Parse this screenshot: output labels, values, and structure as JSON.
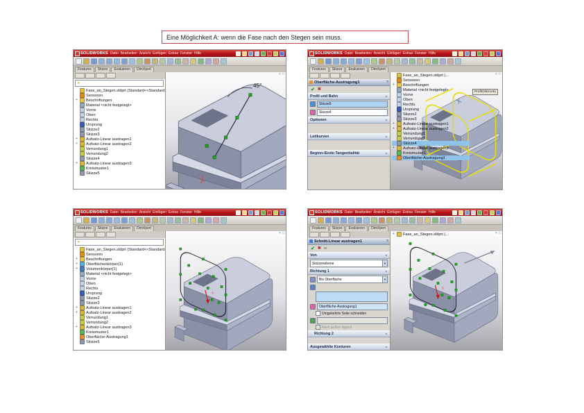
{
  "page": {
    "title_box": "Eine Möglichkeit A: wenn die Fase nach den Stegen sein muss."
  },
  "common": {
    "app_name": "SOLIDWORKS",
    "menu": [
      "Datei",
      "Bearbeiten",
      "Ansicht",
      "Einfügen",
      "Extras",
      "Fenster",
      "Hilfe"
    ],
    "tabs": [
      "Features",
      "Skizze",
      "Evaluieren",
      "DimXpert"
    ],
    "quickbar": [
      {
        "icon": "new"
      },
      {
        "icon": "open"
      },
      {
        "icon": "save"
      },
      {
        "icon": "print"
      },
      {
        "icon": "undo"
      },
      {
        "icon": "rebuild"
      },
      {
        "icon": "options"
      },
      {
        "icon": "help"
      }
    ],
    "toolbar": [
      {
        "icon": "select"
      },
      {
        "icon": "sketch-tool"
      },
      {
        "icon": "line"
      },
      {
        "icon": "rectangle"
      },
      {
        "icon": "circle"
      },
      {
        "icon": "arc"
      },
      {
        "icon": "spline"
      },
      {
        "icon": "ellipse"
      },
      {
        "icon": "sketch-fillet"
      },
      {
        "icon": "trim"
      },
      {
        "icon": "convert-entities"
      },
      {
        "icon": "offset-entities"
      },
      {
        "icon": "mirror-entities"
      },
      {
        "icon": "linear-sketch-pattern"
      },
      {
        "icon": "move-entities"
      },
      {
        "icon": "smart-dimension"
      },
      {
        "icon": "add-relation"
      },
      {
        "icon": "display-relations"
      },
      {
        "icon": "sketch-repair"
      },
      {
        "icon": "quick-snaps"
      }
    ],
    "glyphs": {
      "ok": "✔",
      "cancel": "✖",
      "preview": "∞",
      "chevron": "»",
      "question": "?",
      "funnel": "▼",
      "plus": "+",
      "pan": "+",
      "fit": "□"
    },
    "colors": {
      "titlebar_red": "#b5121b",
      "selection_blue": "#8fc3ea",
      "preview_yellow": "#e4df00",
      "handle_green": "#22a522",
      "model_gray": "#a9aec4"
    }
  },
  "win1": {
    "tree": [
      {
        "icon": "part",
        "label": "Fase_an_Stegen.sldprt (Standard<<Standard>_Anz..."
      },
      {
        "icon": "sensor",
        "label": "Sensoren"
      },
      {
        "icon": "folder",
        "label": "Beschriftungen",
        "plus": true
      },
      {
        "icon": "material",
        "label": "Material <nicht festgelegt>"
      },
      {
        "icon": "plane",
        "label": "Vorne"
      },
      {
        "icon": "plane",
        "label": "Oben"
      },
      {
        "icon": "plane",
        "label": "Rechts"
      },
      {
        "icon": "origin",
        "label": "Ursprung"
      },
      {
        "icon": "sketch",
        "label": "Skizze2"
      },
      {
        "icon": "sketch",
        "label": "Skizze3"
      },
      {
        "icon": "extrude",
        "label": "Aufsatz-Linear austragen1",
        "plus": true
      },
      {
        "icon": "extrude",
        "label": "Aufsatz-Linear austragen2",
        "plus": true
      },
      {
        "icon": "fillet",
        "label": "Verrundung1"
      },
      {
        "icon": "fillet",
        "label": "Verrundung2"
      },
      {
        "icon": "sketch",
        "label": "Skizze4"
      },
      {
        "icon": "extrude",
        "label": "Aufsatz-Linear austragen3",
        "plus": true
      },
      {
        "icon": "pattern",
        "label": "Kreismuster1"
      },
      {
        "icon": "sketch",
        "label": "Skizze5"
      }
    ],
    "viewport": {
      "angle_dimension": "45°"
    }
  },
  "win2": {
    "pm": {
      "title": "Oberfläche-Austragung1",
      "section_profile_path": "Profil und Bahn",
      "profile_value": "Skizze5",
      "path_value": "Skizze4",
      "section_options": "Optionen",
      "section_guide_curves": "Leitkurven",
      "section_tangency": "Beginn-/Ende-Tangentialität"
    },
    "callout": "Profil(Skizze5)",
    "flyout_tree": [
      {
        "icon": "part",
        "label": "Fase_an_Stegen.sldprt (..."
      },
      {
        "icon": "sensor",
        "label": "Sensoren"
      },
      {
        "icon": "folder",
        "label": "Beschriftungen",
        "plus": true
      },
      {
        "icon": "material",
        "label": "Material <nicht festgelegt>"
      },
      {
        "icon": "plane",
        "label": "Vorne"
      },
      {
        "icon": "plane",
        "label": "Oben"
      },
      {
        "icon": "plane",
        "label": "Rechts"
      },
      {
        "icon": "origin",
        "label": "Ursprung"
      },
      {
        "icon": "sketch",
        "label": "Skizze2"
      },
      {
        "icon": "sketch",
        "label": "Skizze3"
      },
      {
        "icon": "extrude",
        "label": "Aufsatz-Linear austragen1",
        "plus": true
      },
      {
        "icon": "extrude",
        "label": "Aufsatz-Linear austragen2",
        "plus": true
      },
      {
        "icon": "fillet",
        "label": "Verrundung1"
      },
      {
        "icon": "fillet",
        "label": "Verrundung2"
      },
      {
        "icon": "sketch",
        "label": "Skizze4",
        "hl": true
      },
      {
        "icon": "extrude",
        "label": "Aufsatz-Linear austragen3",
        "plus": true
      },
      {
        "icon": "pattern",
        "label": "Kreismuster1"
      },
      {
        "icon": "surface-sweep",
        "label": "Oberfläche-Austragung1",
        "hl": true
      }
    ]
  },
  "win3": {
    "tree": [
      {
        "icon": "part",
        "label": "Fase_an_Stegen.sldprt (Standard<<Standard>_Anz..."
      },
      {
        "icon": "sensor",
        "label": "Sensoren"
      },
      {
        "icon": "folder",
        "label": "Beschriftungen",
        "plus": true
      },
      {
        "icon": "surface-bodies",
        "label": "Oberflächenkörper(1)",
        "plus": true
      },
      {
        "icon": "solid-bodies",
        "label": "Volumenkörper(1)",
        "plus": true
      },
      {
        "icon": "material",
        "label": "Material <nicht festgelegt>"
      },
      {
        "icon": "plane",
        "label": "Vorne"
      },
      {
        "icon": "plane",
        "label": "Oben"
      },
      {
        "icon": "plane",
        "label": "Rechts"
      },
      {
        "icon": "origin",
        "label": "Ursprung"
      },
      {
        "icon": "sketch",
        "label": "Skizze2"
      },
      {
        "icon": "sketch",
        "label": "Skizze3"
      },
      {
        "icon": "extrude",
        "label": "Aufsatz-Linear austragen1",
        "plus": true
      },
      {
        "icon": "extrude",
        "label": "Aufsatz-Linear austragen2",
        "plus": true
      },
      {
        "icon": "fillet",
        "label": "Verrundung1"
      },
      {
        "icon": "fillet",
        "label": "Verrundung2"
      },
      {
        "icon": "extrude",
        "label": "Aufsatz-Linear austragen3",
        "plus": true
      },
      {
        "icon": "pattern",
        "label": "Kreismuster1"
      },
      {
        "icon": "surface-sweep",
        "label": "Oberfläche-Austragung1"
      },
      {
        "icon": "sketch",
        "label": "Skizze5"
      }
    ]
  },
  "win4": {
    "pm": {
      "title": "Schnitt-Linear austragen1",
      "section_from": "Von",
      "from_value": "Skizzenebene",
      "section_dir1": "Richtung 1",
      "end_condition": "Bis Oberfläche",
      "surface_value": "Oberfläche-Austragung1",
      "flip_side_label": "Umgekehrte Seite schneiden",
      "draft_outward_label": "Nach außen kippen",
      "section_dir2": "Richtung 2",
      "section_contours": "Ausgewählte Konturen"
    },
    "flyout_root": "Fase_an_Stegen.sldprt (..."
  }
}
